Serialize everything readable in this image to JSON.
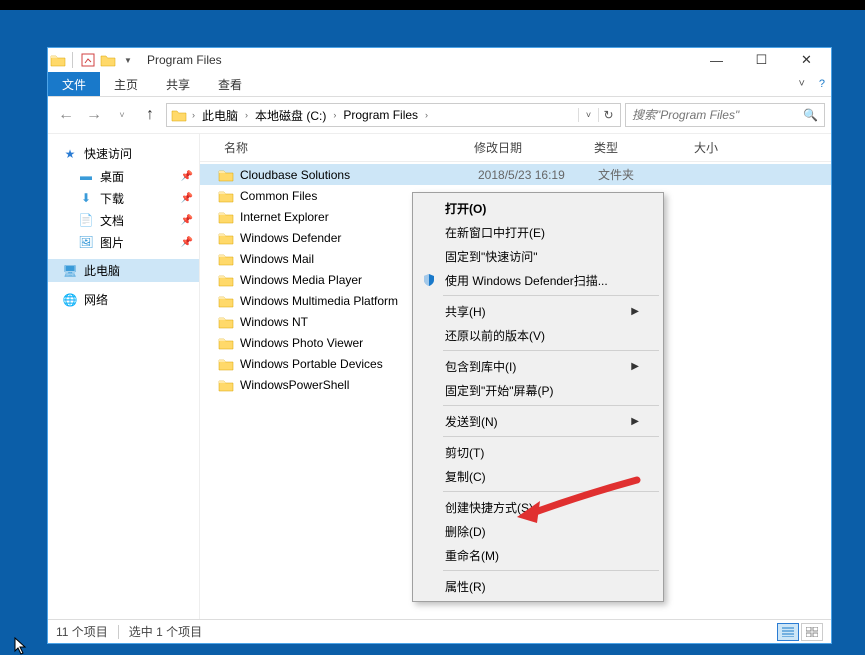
{
  "window": {
    "title": "Program Files",
    "controls": {
      "min": "—",
      "max": "☐",
      "close": "✕"
    }
  },
  "ribbon": {
    "file": "文件",
    "home": "主页",
    "share": "共享",
    "view": "查看"
  },
  "address": {
    "root": "此电脑",
    "drive": "本地磁盘 (C:)",
    "folder": "Program Files"
  },
  "search": {
    "placeholder": "搜索\"Program Files\""
  },
  "nav": {
    "quick_access": "快速访问",
    "desktop": "桌面",
    "downloads": "下载",
    "documents": "文档",
    "pictures": "图片",
    "this_pc": "此电脑",
    "network": "网络"
  },
  "columns": {
    "name": "名称",
    "date": "修改日期",
    "type": "类型",
    "size": "大小"
  },
  "files": [
    {
      "name": "Cloudbase Solutions",
      "date": "2018/5/23 16:19",
      "type": "文件夹",
      "selected": true
    },
    {
      "name": "Common Files"
    },
    {
      "name": "Internet Explorer"
    },
    {
      "name": "Windows Defender"
    },
    {
      "name": "Windows Mail"
    },
    {
      "name": "Windows Media Player"
    },
    {
      "name": "Windows Multimedia Platform"
    },
    {
      "name": "Windows NT"
    },
    {
      "name": "Windows Photo Viewer"
    },
    {
      "name": "Windows Portable Devices"
    },
    {
      "name": "WindowsPowerShell"
    }
  ],
  "context_menu": {
    "open": "打开(O)",
    "open_new": "在新窗口中打开(E)",
    "pin_quick": "固定到\"快速访问\"",
    "defender": "使用 Windows Defender扫描...",
    "share": "共享(H)",
    "restore": "还原以前的版本(V)",
    "include": "包含到库中(I)",
    "pin_start": "固定到\"开始\"屏幕(P)",
    "send_to": "发送到(N)",
    "cut": "剪切(T)",
    "copy": "复制(C)",
    "shortcut": "创建快捷方式(S)",
    "delete": "删除(D)",
    "rename": "重命名(M)",
    "properties": "属性(R)"
  },
  "status": {
    "count": "11 个项目",
    "selected": "选中 1 个项目"
  }
}
